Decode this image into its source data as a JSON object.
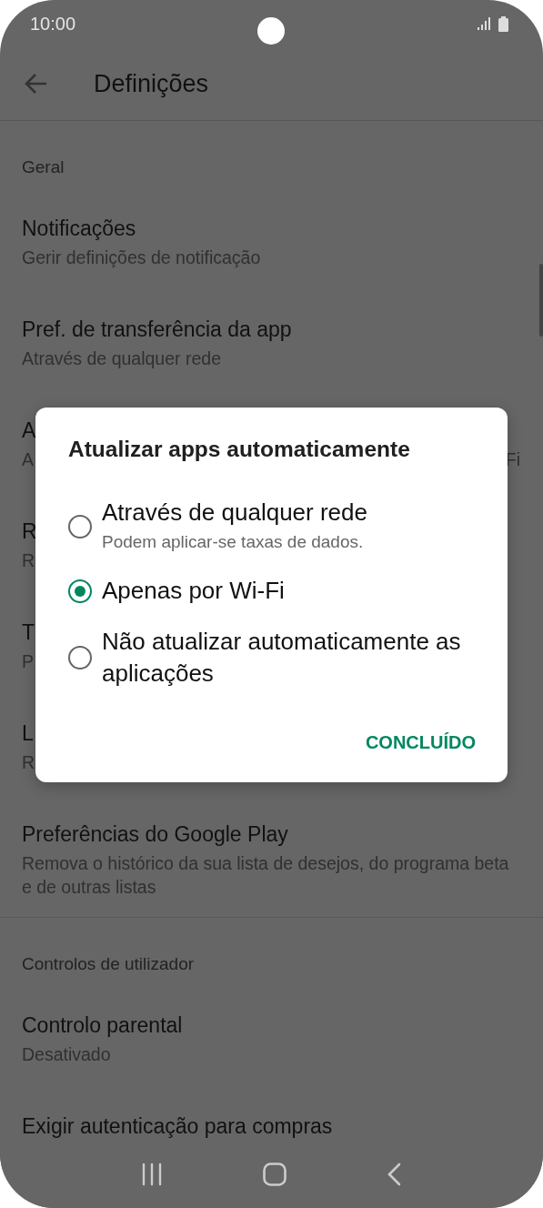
{
  "status_bar": {
    "time": "10:00"
  },
  "app_bar": {
    "title": "Definições"
  },
  "sections": [
    {
      "header": "Geral",
      "items": [
        {
          "title": "Notificações",
          "subtitle": "Gerir definições de notificação"
        },
        {
          "title": "Pref. de transferência da app",
          "subtitle": "Através de qualquer rede"
        },
        {
          "title": "A",
          "subtitle": "A",
          "subtitle_end": "Fi"
        },
        {
          "title": "R",
          "subtitle": "R"
        },
        {
          "title": "T",
          "subtitle": "P"
        },
        {
          "title": "L",
          "subtitle": "R"
        },
        {
          "title": "Preferências do Google Play",
          "subtitle": "Remova o histórico da sua lista de desejos, do programa beta e de outras listas"
        }
      ]
    },
    {
      "header": "Controlos de utilizador",
      "items": [
        {
          "title": "Controlo parental",
          "subtitle": "Desativado"
        },
        {
          "title": "Exigir autenticação para compras"
        }
      ]
    }
  ],
  "dialog": {
    "title": "Atualizar apps automaticamente",
    "options": [
      {
        "label": "Através de qualquer rede",
        "hint": "Podem aplicar-se taxas de dados.",
        "selected": false
      },
      {
        "label": "Apenas por Wi-Fi",
        "selected": true
      },
      {
        "label": "Não atualizar automaticamente as aplicações",
        "selected": false
      }
    ],
    "button": "CONCLUÍDO"
  }
}
